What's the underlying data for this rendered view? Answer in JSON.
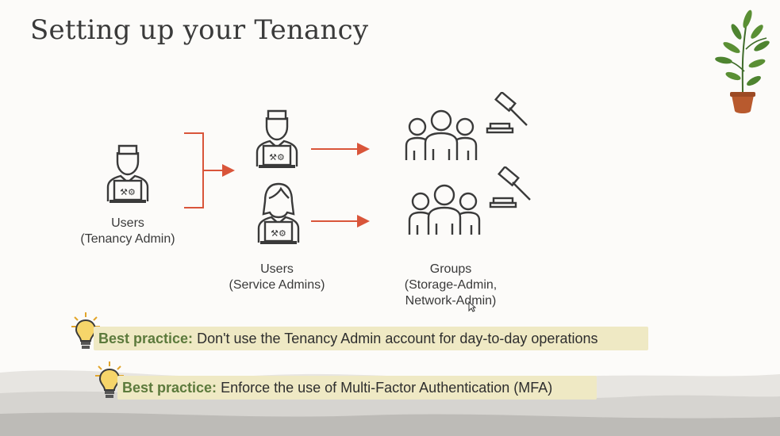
{
  "slide": {
    "title": "Setting up your Tenancy"
  },
  "diagram": {
    "tenancy_admin": {
      "line1": "Users",
      "line2": "(Tenancy Admin)"
    },
    "service_admins": {
      "line1": "Users",
      "line2": "(Service Admins)"
    },
    "groups": {
      "line1": "Groups",
      "line2": "(Storage-Admin,",
      "line3": "Network-Admin)"
    },
    "arrow_color": "#d9553a"
  },
  "best_practices": [
    {
      "prefix": "Best practice:",
      "text": " Don't use the Tenancy Admin account for day-to-day operations"
    },
    {
      "prefix": "Best practice:",
      "text": " Enforce the use of Multi-Factor Authentication (MFA)"
    }
  ],
  "colors": {
    "highlight": "#efe9c4",
    "prefix_green": "#5c7a3c",
    "icon_stroke": "#3a3a3a"
  },
  "icons": [
    "admin-user-icon",
    "male-service-admin-icon",
    "female-service-admin-icon",
    "group-icon",
    "gavel-icon",
    "lightbulb-icon",
    "plant-icon"
  ]
}
